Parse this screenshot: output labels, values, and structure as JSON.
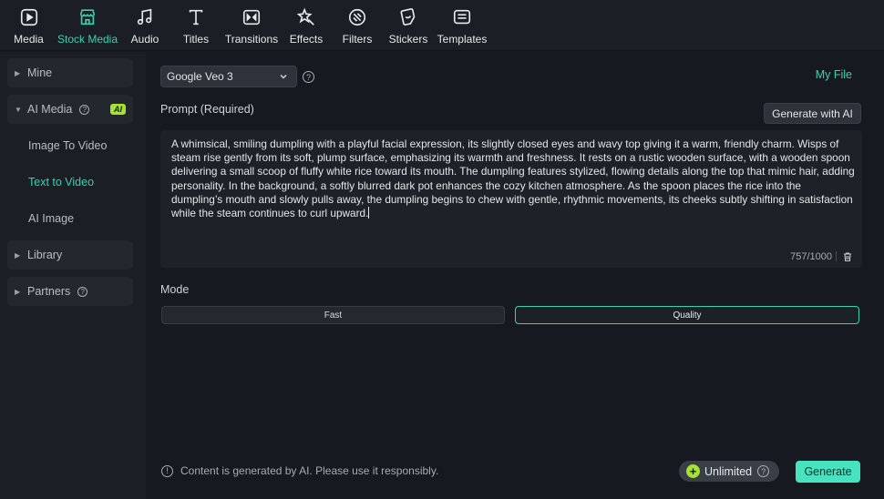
{
  "toolbar": {
    "items": [
      {
        "label": "Media",
        "icon": "media-icon"
      },
      {
        "label": "Stock Media",
        "icon": "stock-media-icon",
        "active": true
      },
      {
        "label": "Audio",
        "icon": "audio-icon"
      },
      {
        "label": "Titles",
        "icon": "titles-icon"
      },
      {
        "label": "Transitions",
        "icon": "transitions-icon"
      },
      {
        "label": "Effects",
        "icon": "effects-icon"
      },
      {
        "label": "Filters",
        "icon": "filters-icon"
      },
      {
        "label": "Stickers",
        "icon": "stickers-icon"
      },
      {
        "label": "Templates",
        "icon": "templates-icon"
      }
    ]
  },
  "sidebar": {
    "mine": "Mine",
    "ai_media": "AI Media",
    "ai_badge": "AI",
    "sub_items": [
      "Image To Video",
      "Text to Video",
      "AI Image"
    ],
    "library": "Library",
    "partners": "Partners"
  },
  "main": {
    "model": "Google Veo 3",
    "my_file": "My File",
    "prompt_label": "Prompt (Required)",
    "generate_with_ai": "Generate with AI",
    "prompt_text": "A whimsical, smiling dumpling with a playful facial expression, its slightly closed eyes and wavy top giving it a warm, friendly charm. Wisps of steam rise gently from its soft, plump surface, emphasizing its warmth and freshness. It rests on a rustic wooden surface, with a wooden spoon delivering a small scoop of fluffy white rice toward its mouth. The dumpling features stylized, flowing details along the top that mimic hair, adding personality. In the background, a softly blurred dark pot enhances the cozy kitchen atmosphere. As the spoon places the rice into the dumpling’s mouth and slowly pulls away, the dumpling begins to chew with gentle, rhythmic movements, its cheeks subtly shifting in satisfaction while the steam continues to curl upward.",
    "counter": "757/1000",
    "mode_label": "Mode",
    "mode_fast": "Fast",
    "mode_quality": "Quality",
    "notice": "Content is generated by AI. Please use it responsibly.",
    "unlimited": "Unlimited",
    "generate": "Generate"
  },
  "colors": {
    "accent": "#39d2b0",
    "generate_button": "#47e2bf",
    "badge": "#a6e22e"
  }
}
